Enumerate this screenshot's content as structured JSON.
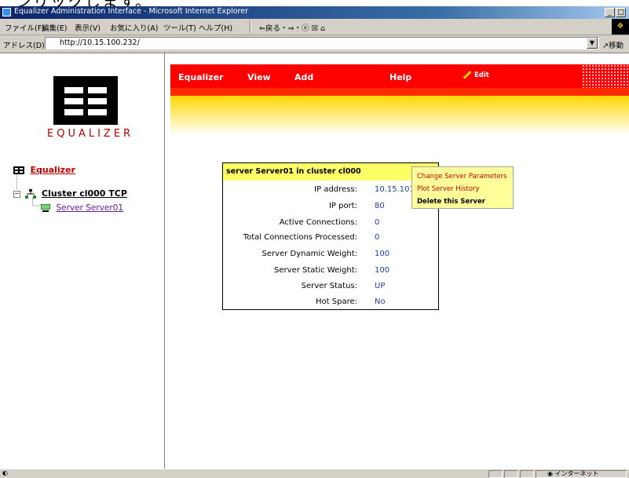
{
  "caption_fragment": "ンリックします。",
  "window": {
    "title": "Equalizer Administration Interface - Microsoft Internet Explorer",
    "buttons": [
      "_",
      "□"
    ]
  },
  "menubar": {
    "items": [
      "ファイル(F)",
      "編集(E)",
      "表示(V)",
      "お気に入り(A)",
      "ツール(T)",
      "ヘルプ(H)"
    ],
    "toolbar": "⇐戻る・⇒・ⓧ ☒ ⌂"
  },
  "addressbar": {
    "label": "アドレス(D)",
    "url": "http://10.15.100.232/",
    "go_label": "移動"
  },
  "left": {
    "logo_text": "EQUALIZER",
    "tree": {
      "root": "Equalizer",
      "cluster": "Cluster cl000 TCP",
      "server": "Server Server01"
    }
  },
  "nav": {
    "items": [
      "Equalizer",
      "View",
      "Add",
      "Help"
    ],
    "edit": "Edit"
  },
  "panel": {
    "title": "server Server01 in cluster cl000",
    "rows": [
      {
        "key": "IP address:",
        "value": "10.15.101"
      },
      {
        "key": "IP port:",
        "value": "80"
      },
      {
        "key": "Active Connections:",
        "value": "0"
      },
      {
        "key": "Total Connections Processed:",
        "value": "0"
      },
      {
        "key": "Server Dynamic Weight:",
        "value": "100"
      },
      {
        "key": "Server Static Weight:",
        "value": "100"
      },
      {
        "key": "Server Status:",
        "value": "UP"
      },
      {
        "key": "Hot Spare:",
        "value": "No"
      }
    ]
  },
  "context_menu": {
    "items": [
      "Change Server Parameters",
      "Plot Server History",
      "Delete this Server"
    ]
  },
  "statusbar": {
    "zone": "インターネット"
  },
  "colors": {
    "nav_red": "#ff0000",
    "panel_header": "#ffff66",
    "menu_bg": "#ffff99",
    "link_red": "#c00000",
    "value_blue": "#1f3fa0"
  }
}
